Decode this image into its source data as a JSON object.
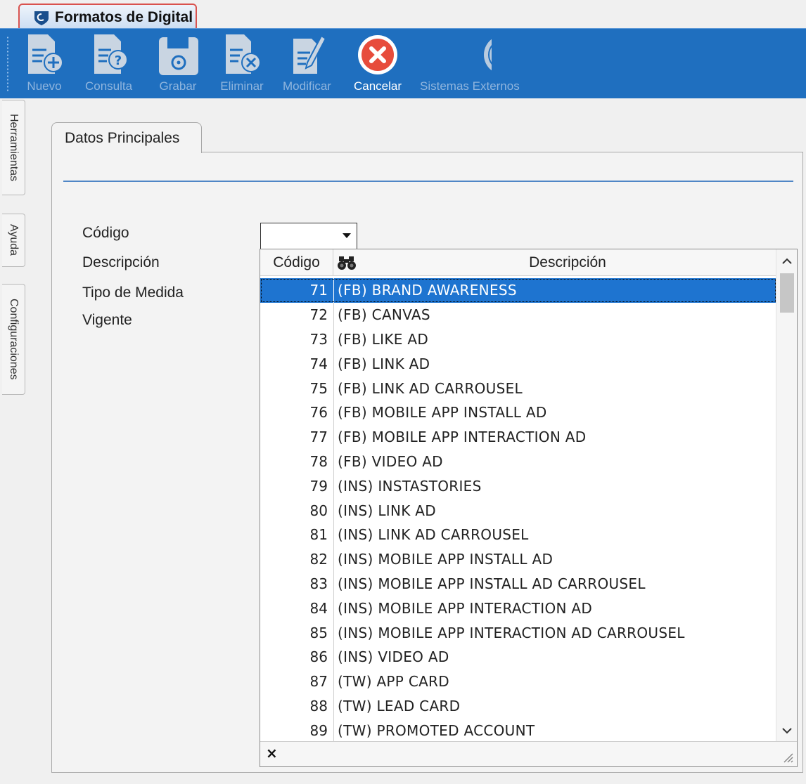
{
  "window": {
    "title": "Formatos de Digital"
  },
  "toolbar": {
    "buttons": [
      {
        "label": "Nuevo",
        "icon": "document-add-icon",
        "enabled": false
      },
      {
        "label": "Consulta",
        "icon": "document-query-icon",
        "enabled": false
      },
      {
        "label": "Grabar",
        "icon": "floppy-disk-icon",
        "enabled": false
      },
      {
        "label": "Eliminar",
        "icon": "document-delete-icon",
        "enabled": false
      },
      {
        "label": "Modificar",
        "icon": "document-edit-icon",
        "enabled": false
      },
      {
        "label": "Cancelar",
        "icon": "cancel-icon",
        "enabled": true
      },
      {
        "label": "Sistemas Externos",
        "icon": "external-systems-icon",
        "enabled": false
      }
    ],
    "active_color": "#e74c3c"
  },
  "side_tabs": [
    "Herramientas",
    "Ayuda",
    "Configuraciones"
  ],
  "tab": {
    "label": "Datos Principales"
  },
  "form": {
    "codigo_label": "Código",
    "descripcion_label": "Descripción",
    "tipo_medida_label": "Tipo de Medida",
    "vigente_label": "Vigente",
    "codigo_value": ""
  },
  "dropdown": {
    "header_code": "Código",
    "header_desc": "Descripción",
    "search_icon": "binoculars-icon",
    "close_label": "×",
    "selected_index": 0,
    "rows": [
      {
        "code": "71",
        "desc": "(FB) BRAND AWARENESS"
      },
      {
        "code": "72",
        "desc": "(FB) CANVAS"
      },
      {
        "code": "73",
        "desc": "(FB) LIKE AD"
      },
      {
        "code": "74",
        "desc": "(FB) LINK AD"
      },
      {
        "code": "75",
        "desc": "(FB) LINK AD CARROUSEL"
      },
      {
        "code": "76",
        "desc": "(FB) MOBILE APP INSTALL AD"
      },
      {
        "code": "77",
        "desc": "(FB) MOBILE APP INTERACTION AD"
      },
      {
        "code": "78",
        "desc": "(FB) VIDEO AD"
      },
      {
        "code": "79",
        "desc": "(INS) INSTASTORIES"
      },
      {
        "code": "80",
        "desc": "(INS) LINK AD"
      },
      {
        "code": "81",
        "desc": "(INS) LINK AD CARROUSEL"
      },
      {
        "code": "82",
        "desc": "(INS) MOBILE APP INSTALL AD"
      },
      {
        "code": "83",
        "desc": "(INS) MOBILE APP INSTALL AD CARROUSEL"
      },
      {
        "code": "84",
        "desc": "(INS) MOBILE APP INTERACTION AD"
      },
      {
        "code": "85",
        "desc": "(INS) MOBILE APP INTERACTION AD CARROUSEL"
      },
      {
        "code": "86",
        "desc": "(INS) VIDEO AD"
      },
      {
        "code": "87",
        "desc": "(TW) APP CARD"
      },
      {
        "code": "88",
        "desc": "(TW) LEAD CARD"
      },
      {
        "code": "89",
        "desc": "(TW) PROMOTED ACCOUNT"
      }
    ]
  }
}
